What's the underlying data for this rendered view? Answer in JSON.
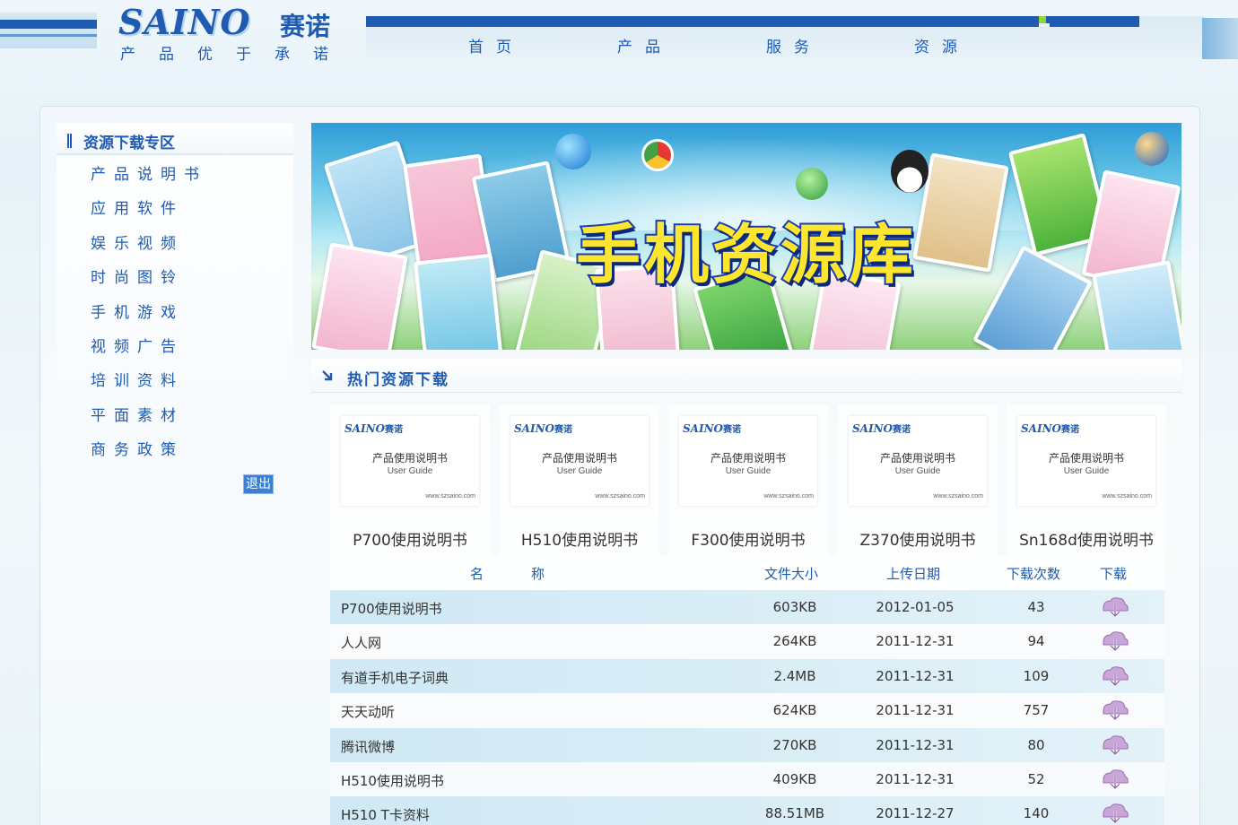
{
  "header": {
    "logo_text": "SAINO",
    "logo_cn": "赛诺",
    "slogan": "产品优于承诺"
  },
  "nav": {
    "items": [
      {
        "label": "首页"
      },
      {
        "label": "产品"
      },
      {
        "label": "服务"
      },
      {
        "label": "资源"
      }
    ]
  },
  "sidebar": {
    "title": "资源下载专区",
    "items": [
      {
        "label": "产品说明书"
      },
      {
        "label": "应用软件"
      },
      {
        "label": "娱乐视频"
      },
      {
        "label": "时尚图铃"
      },
      {
        "label": "手机游戏"
      },
      {
        "label": "视频广告"
      },
      {
        "label": "培训资料"
      },
      {
        "label": "平面素材"
      },
      {
        "label": "商务政策"
      }
    ],
    "logout_label": "退出"
  },
  "banner": {
    "title": "手机资源库"
  },
  "hot": {
    "title": "热门资源下载",
    "card": {
      "logo": "SAINO",
      "logo_cn": "赛诺",
      "title": "产品使用说明书",
      "subtitle": "User Guide",
      "url": "www.szsaino.com"
    },
    "items": [
      {
        "label": "P700使用说明书"
      },
      {
        "label": "H510使用说明书"
      },
      {
        "label": "F300使用说明书"
      },
      {
        "label": "Z370使用说明书"
      },
      {
        "label": "Sn168d使用说明书"
      }
    ]
  },
  "table": {
    "headers": {
      "name_1": "名",
      "name_2": "称",
      "size": "文件大小",
      "date": "上传日期",
      "count": "下载次数",
      "download": "下载"
    },
    "rows": [
      {
        "name": "P700使用说明书",
        "size": "603KB",
        "date": "2012-01-05",
        "count": "43"
      },
      {
        "name": "人人网",
        "size": "264KB",
        "date": "2011-12-31",
        "count": "94"
      },
      {
        "name": "有道手机电子词典",
        "size": "2.4MB",
        "date": "2011-12-31",
        "count": "109"
      },
      {
        "name": "天天动听",
        "size": "624KB",
        "date": "2011-12-31",
        "count": "757"
      },
      {
        "name": "腾讯微博",
        "size": "270KB",
        "date": "2011-12-31",
        "count": "80"
      },
      {
        "name": "H510使用说明书",
        "size": "409KB",
        "date": "2011-12-31",
        "count": "52"
      },
      {
        "name": "H510 T卡资料",
        "size": "88.51MB",
        "date": "2011-12-27",
        "count": "140"
      }
    ]
  },
  "colors": {
    "brand_blue": "#1f5bb1",
    "accent_green": "#8cd63a",
    "banner_title_fill": "#ffe62e"
  }
}
